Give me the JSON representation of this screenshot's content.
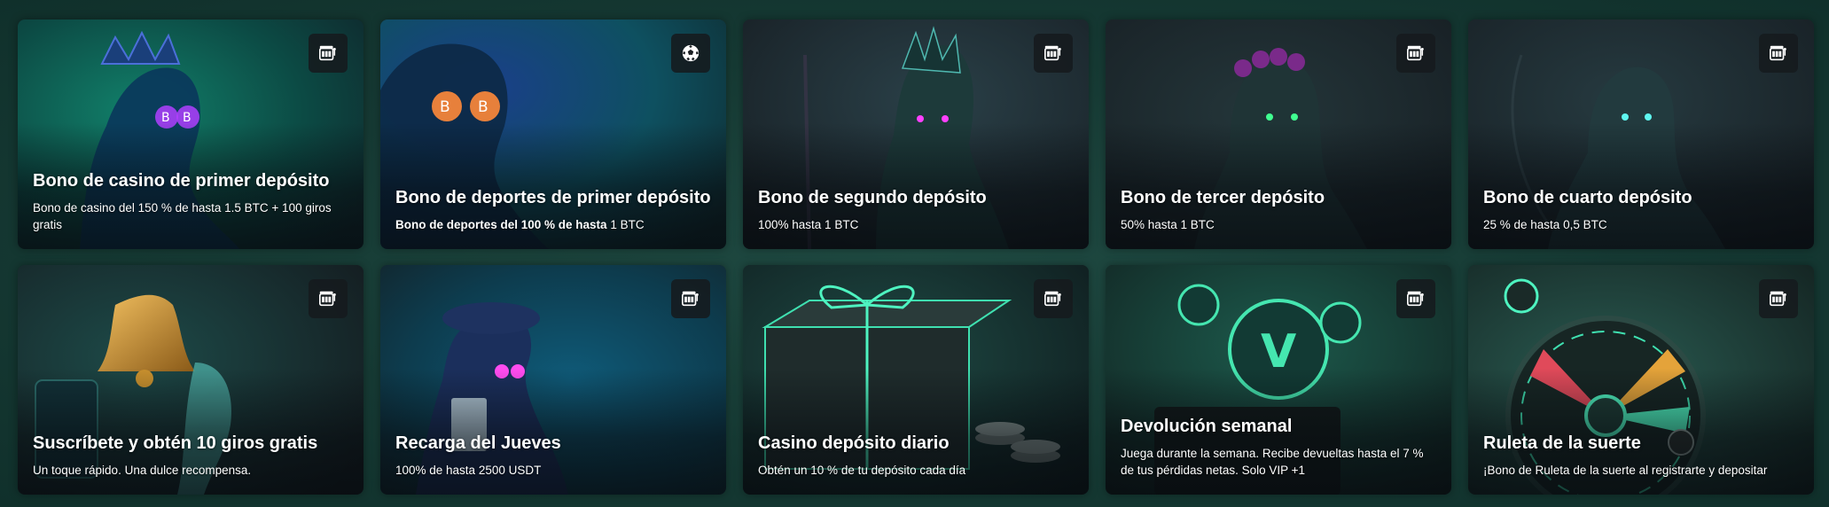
{
  "promotions": [
    {
      "title": "Bono de casino de primer depósito",
      "desc": "Bono de casino del 150 % de hasta 1.5 BTC + 100 giros gratis",
      "type_icon": "slot-machine-icon",
      "accent": "#1fd49a"
    },
    {
      "title": "Bono de deportes de primer depósito",
      "desc_bold": "Bono de deportes del 100 % de hasta",
      "desc_rest": " 1 BTC",
      "type_icon": "soccer-ball-icon",
      "accent": "#2aa5e0"
    },
    {
      "title": "Bono de segundo depósito",
      "desc": "100% hasta 1 BTC",
      "type_icon": "slot-machine-icon",
      "accent": "#ff3cf0"
    },
    {
      "title": "Bono de tercer depósito",
      "desc": "50% hasta 1 BTC",
      "type_icon": "slot-machine-icon",
      "accent": "#2dff8a"
    },
    {
      "title": "Bono de cuarto depósito",
      "desc": "25 % de hasta 0,5 BTC",
      "type_icon": "slot-machine-icon",
      "accent": "#3ff0e8"
    },
    {
      "title": "Suscríbete y obtén 10 giros gratis",
      "desc": "Un toque rápido. Una dulce recompensa.",
      "type_icon": "slot-machine-icon",
      "accent": "#d4a038"
    },
    {
      "title": "Recarga del Jueves",
      "desc": "100% de hasta 2500 USDT",
      "type_icon": "slot-machine-icon",
      "accent": "#ff5cf2"
    },
    {
      "title": "Casino depósito diario",
      "desc": "Obtén un 10 % de tu depósito cada día",
      "type_icon": "slot-machine-icon",
      "accent": "#4ef3c0"
    },
    {
      "title": "Devolución semanal",
      "desc": "Juega durante la semana. Recibe devueltas hasta el 7 % de tus pérdidas netas. Solo VIP +1",
      "type_icon": "slot-machine-icon",
      "accent": "#45e6b0"
    },
    {
      "title": "Ruleta de la suerte",
      "desc": "¡Bono de Ruleta de la suerte al registrarte y depositar",
      "type_icon": "slot-machine-icon",
      "accent": "#3fe0b0"
    }
  ]
}
